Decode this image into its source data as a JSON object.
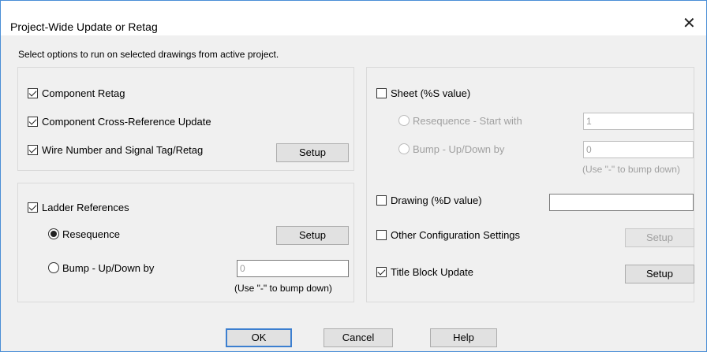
{
  "window": {
    "title": "Project-Wide Update or Retag"
  },
  "instruction": "Select options to run on selected drawings from active project.",
  "left_group1": {
    "component_retag": {
      "label": "Component Retag",
      "checked": true
    },
    "cross_reference": {
      "label": "Component Cross-Reference Update",
      "checked": true
    },
    "wire_number": {
      "label": "Wire Number and Signal Tag/Retag",
      "checked": true
    },
    "setup_label": "Setup"
  },
  "left_group2": {
    "ladder_references": {
      "label": "Ladder References",
      "checked": true
    },
    "resequence": {
      "label": "Resequence",
      "selected": true
    },
    "resequence_setup": "Setup",
    "bump": {
      "label": "Bump - Up/Down by",
      "selected": false
    },
    "bump_value": "0",
    "bump_hint": "(Use \"-\" to bump down)"
  },
  "right_group": {
    "sheet": {
      "label": "Sheet (%S value)",
      "checked": false
    },
    "resequence_start": {
      "label": "Resequence - Start with",
      "value": "1"
    },
    "bump": {
      "label": "Bump - Up/Down by",
      "value": "0"
    },
    "bump_hint": "(Use \"-\" to bump down)",
    "drawing": {
      "label": "Drawing (%D value)",
      "checked": false,
      "value": ""
    },
    "other_config": {
      "label": "Other Configuration Settings",
      "checked": false,
      "setup": "Setup"
    },
    "title_block": {
      "label": "Title Block Update",
      "checked": true,
      "setup": "Setup"
    }
  },
  "buttons": {
    "ok": "OK",
    "cancel": "Cancel",
    "help": "Help"
  }
}
